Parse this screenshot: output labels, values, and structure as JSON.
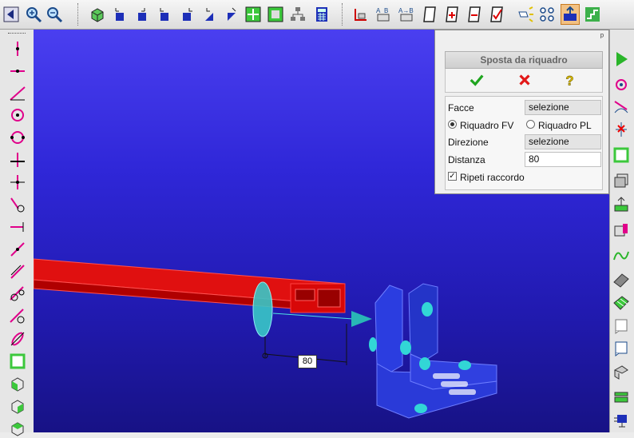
{
  "toolbar": {
    "tools": [
      "back-arrow-icon",
      "zoom-in-icon",
      "zoom-out-icon",
      "cube-view-icon",
      "view-front-icon",
      "view-right-icon",
      "view-top-icon",
      "view-left-icon",
      "view-back-icon",
      "view-bottom-icon",
      "fit-all-icon",
      "frame-icon",
      "tree-icon",
      "calculator-icon",
      "measure-icon",
      "rename-ab-icon",
      "rename-arrow-icon",
      "document-icon",
      "add-document-icon",
      "remove-document-icon",
      "check-document-icon",
      "light-icon",
      "dots-icon",
      "layer-active-icon",
      "step-icon"
    ]
  },
  "left_toolbar": {
    "tools": [
      "vertical-line-icon",
      "horizontal-line-icon",
      "angled-line-icon",
      "circle-center-icon",
      "circle-icon",
      "cross-icon",
      "cross-small-icon",
      "hook-icon",
      "horizontal-arrow-icon",
      "diagonal-line-icon",
      "diagonal-line-2-icon",
      "tangent-circle-icon",
      "tangent-circle-2-icon",
      "ellipse-icon",
      "square-icon",
      "box-icon",
      "box-2-icon",
      "box-3-icon"
    ]
  },
  "right_toolbar": {
    "tools": [
      "play-icon",
      "circle-target-icon",
      "arc-icon",
      "star-line-icon",
      "green-square-icon",
      "stack-icon",
      "lift-icon",
      "extrude-icon",
      "wave-icon",
      "wedge-icon",
      "grid-icon",
      "note-icon",
      "note-2-icon",
      "twist-icon",
      "layers-icon",
      "screen-icon"
    ]
  },
  "panel": {
    "pin": "ᵖ",
    "title": "Sposta da riquadro",
    "confirm_icon": "confirm-check-icon",
    "cancel_icon": "cancel-x-icon",
    "help_icon": "help-question-icon",
    "facce_label": "Facce",
    "facce_value": "selezione",
    "radio_fv_label": "Riquadro FV",
    "radio_pl_label": "Riquadro PL",
    "direzione_label": "Direzione",
    "direzione_value": "selezione",
    "distanza_label": "Distanza",
    "distanza_value": "80",
    "ripeti_label": "Ripeti raccordo"
  },
  "viewport": {
    "dimension_value": "80"
  }
}
